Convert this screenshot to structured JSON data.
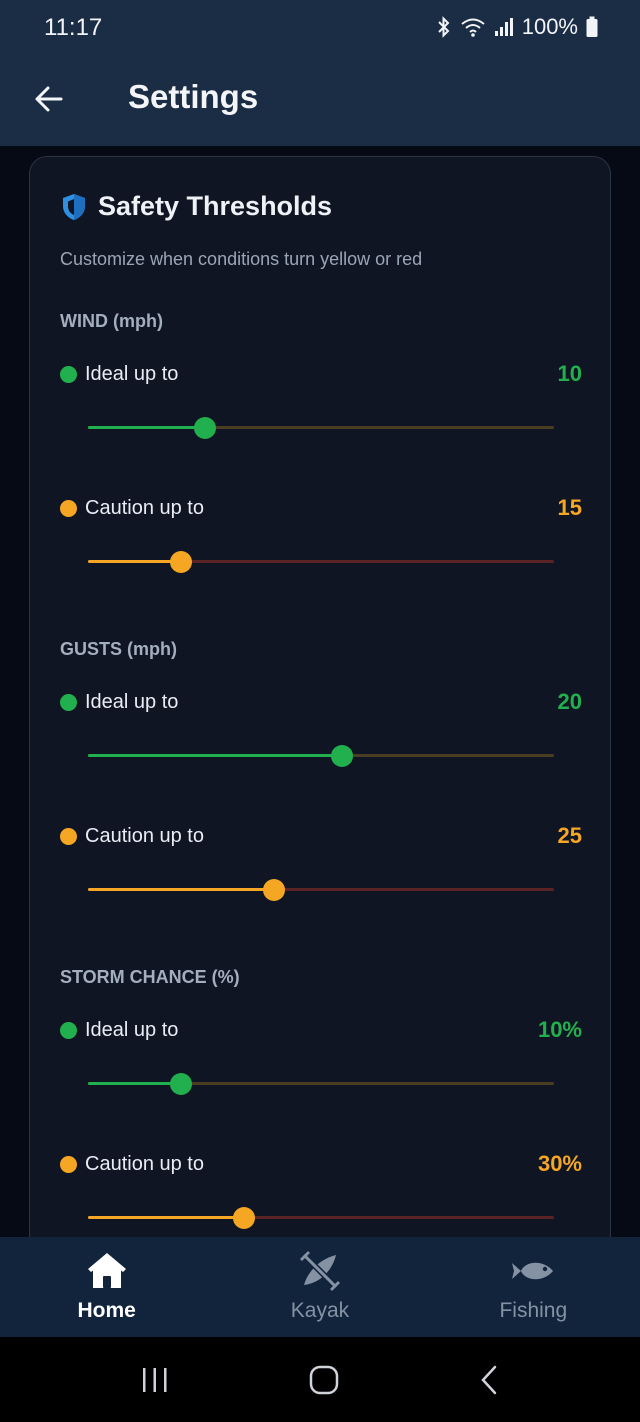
{
  "status_bar": {
    "time": "11:17",
    "battery": "100%"
  },
  "app_bar": {
    "title": "Settings"
  },
  "card": {
    "title": "Safety Thresholds",
    "subtitle": "Customize when conditions turn yellow or red"
  },
  "colors": {
    "ideal": "#22b04e",
    "caution": "#f5a623",
    "danger_track": "#5a2222",
    "ideal_track": "#4a3e22"
  },
  "sections": [
    {
      "label": "WIND (mph)",
      "ideal": {
        "label": "Ideal up to",
        "value": "10",
        "level": 0.25
      },
      "caution": {
        "label": "Caution up to",
        "value": "15",
        "level": 0.2
      }
    },
    {
      "label": "GUSTS (mph)",
      "ideal": {
        "label": "Ideal up to",
        "value": "20",
        "level": 0.545
      },
      "caution": {
        "label": "Caution up to",
        "value": "25",
        "level": 0.4
      }
    },
    {
      "label": "STORM CHANCE (%)",
      "ideal": {
        "label": "Ideal up to",
        "value": "10%",
        "level": 0.2
      },
      "caution": {
        "label": "Caution up to",
        "value": "30%",
        "level": 0.335
      }
    }
  ],
  "bottom_nav": [
    {
      "label": "Home",
      "icon": "home-icon",
      "active": true
    },
    {
      "label": "Kayak",
      "icon": "kayak-icon",
      "active": false
    },
    {
      "label": "Fishing",
      "icon": "fish-icon",
      "active": false
    }
  ]
}
